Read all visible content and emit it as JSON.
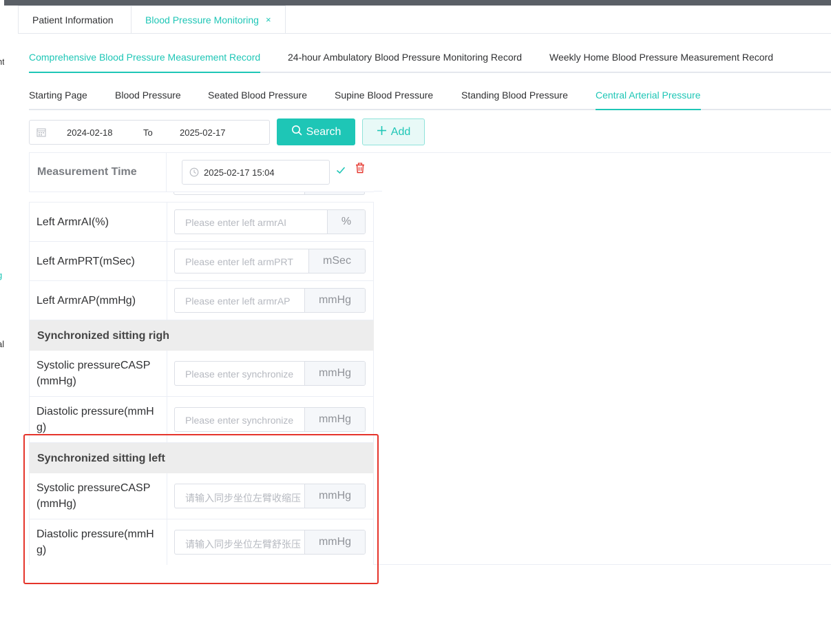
{
  "page_tabs": {
    "patient_info": "Patient Information",
    "bp_monitoring": "Blood Pressure Monitoring",
    "close": "×"
  },
  "record_tabs": [
    "Comprehensive Blood Pressure Measurement Record",
    "24-hour Ambulatory Blood Pressure Monitoring Record",
    "Weekly Home Blood Pressure Measurement Record"
  ],
  "sub_tabs": [
    "Starting Page",
    "Blood Pressure",
    "Seated Blood Pressure",
    "Supine Blood Pressure",
    "Standing Blood Pressure",
    "Central Arterial Pressure"
  ],
  "toolbar": {
    "date_start": "2024-02-18",
    "date_to": "To",
    "date_end": "2025-02-17",
    "search_label": "Search",
    "add_label": "Add"
  },
  "measurement": {
    "label": "Measurement Time",
    "value": "2025-02-17 15:04"
  },
  "left_arm_rows": [
    {
      "label": "Left ArmrAI(%)",
      "placeholder": "Please enter left armrAI",
      "unit": "%"
    },
    {
      "label": "Left ArmPRT(mSec)",
      "placeholder": "Please enter left armPRT",
      "unit": "mSec"
    },
    {
      "label": "Left ArmrAP(mmHg)",
      "placeholder": "Please enter left armrAP",
      "unit": "mmHg"
    }
  ],
  "section_right": {
    "title": "Synchronized sitting righ",
    "rows": [
      {
        "label_line1": "Systolic pressureCASP",
        "label_line2": "(mmHg)",
        "placeholder": "Please enter synchronize",
        "unit": "mmHg"
      },
      {
        "label_line1": "Diastolic pressure(mmH",
        "label_line2": "g)",
        "placeholder": "Please enter synchronize",
        "unit": "mmHg"
      }
    ]
  },
  "section_left": {
    "title": "Synchronized sitting left",
    "rows": [
      {
        "label_line1": "Systolic pressureCASP",
        "label_line2": "(mmHg)",
        "placeholder": "请输入同步坐位左臂收缩压",
        "unit": "mmHg"
      },
      {
        "label_line1": "Diastolic pressure(mmH",
        "label_line2": "g)",
        "placeholder": "请输入同步坐位左臂舒张压",
        "unit": "mmHg"
      }
    ]
  },
  "left_strip_glyphs": [
    "nt",
    "g",
    "al"
  ],
  "colors": {
    "accent": "#1ec6b6",
    "danger": "#e5332a",
    "highlight": "#e5332a"
  }
}
